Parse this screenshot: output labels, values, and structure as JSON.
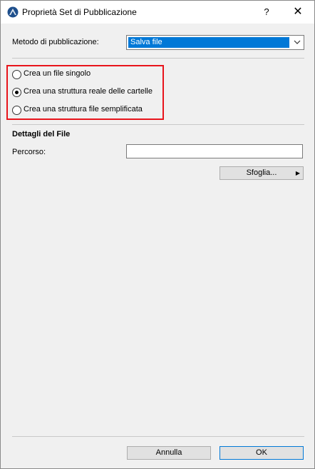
{
  "window": {
    "title": "Proprietà Set di Pubblicazione",
    "help_label": "?",
    "close_label": "✕"
  },
  "method": {
    "label": "Metodo di pubblicazione:",
    "selected": "Salva file"
  },
  "options": {
    "items": [
      {
        "label": "Crea un file singolo",
        "checked": false
      },
      {
        "label": "Crea una struttura reale delle cartelle",
        "checked": true
      },
      {
        "label": "Crea una struttura file semplificata",
        "checked": false
      }
    ]
  },
  "file_details": {
    "title": "Dettagli del File",
    "path_label": "Percorso:",
    "path_value": "",
    "browse_label": "Sfoglia..."
  },
  "footer": {
    "cancel_label": "Annulla",
    "ok_label": "OK"
  },
  "colors": {
    "highlight": "#e8141b",
    "selection": "#0078d7",
    "dialog_bg": "#f0f0f0"
  }
}
